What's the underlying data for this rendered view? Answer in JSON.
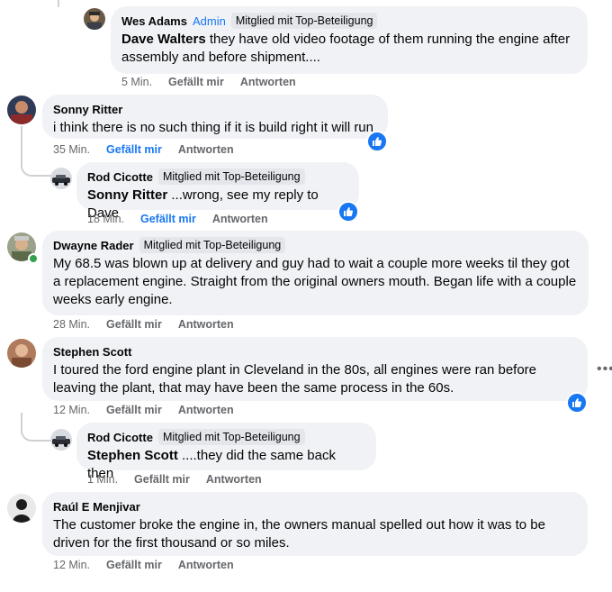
{
  "labels": {
    "like": "Gefällt mir",
    "reply": "Antworten"
  },
  "comments": [
    {
      "author": "Wes Adams",
      "role": "Admin",
      "badge": "Mitglied mit Top-Beteiligung",
      "mention": "Dave Walters",
      "text": "they have old video footage of them running the engine after assembly and before shipment....",
      "time": "5 Min.",
      "liked": false
    },
    {
      "author": "Sonny Ritter",
      "text": "i think there is no such thing if it is build right it will run",
      "time": "35 Min.",
      "liked": true
    },
    {
      "author": "Rod Cicotte",
      "badge": "Mitglied mit Top-Beteiligung",
      "mention": "Sonny Ritter",
      "text": "...wrong, see my reply to Dave",
      "time": "18 Min.",
      "liked": true
    },
    {
      "author": "Dwayne Rader",
      "badge": "Mitglied mit Top-Beteiligung",
      "text": "My 68.5 was blown up at delivery and guy had to wait a couple more weeks til they got a replacement engine. Straight from the original owners mouth. Began life with a couple weeks early engine.",
      "time": "28 Min.",
      "liked": false
    },
    {
      "author": "Stephen Scott",
      "text": "I toured the ford engine plant in Cleveland in the 80s, all engines were ran before leaving the plant, that may have been the same process in the 60s.",
      "time": "12 Min.",
      "liked": false
    },
    {
      "author": "Rod Cicotte",
      "badge": "Mitglied mit Top-Beteiligung",
      "mention": "Stephen Scott",
      "text": "....they did the same back then",
      "time": "1 Min.",
      "liked": false
    },
    {
      "author": "Raúl E Menjivar",
      "text": "The customer broke the engine in, the owners manual spelled out how it was to be driven for the first thousand or so miles.",
      "time": "12 Min.",
      "liked": false
    }
  ],
  "colors": {
    "accent": "#1877f2",
    "bubble": "#f0f2f5",
    "meta": "#65676b"
  }
}
